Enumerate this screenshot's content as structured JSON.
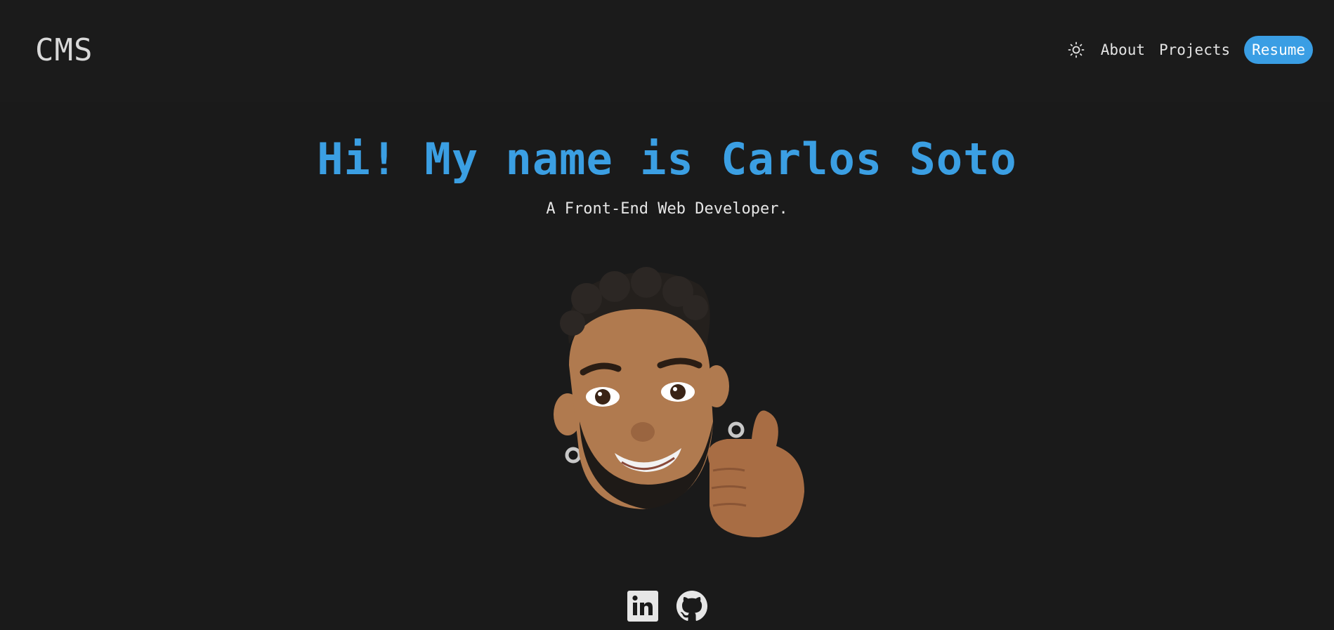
{
  "header": {
    "logo": "CMS",
    "nav": {
      "theme_icon": "sun-icon",
      "about": "About",
      "projects": "Projects",
      "resume": "Resume"
    }
  },
  "hero": {
    "title": "Hi! My name is Carlos Soto",
    "subtitle": "A Front-End Web Developer.",
    "avatar_icon": "memoji-thumbs-up-avatar"
  },
  "socials": {
    "linkedin_icon": "linkedin-icon",
    "github_icon": "github-icon"
  },
  "colors": {
    "background": "#1a1a1a",
    "accent": "#3b9fe3",
    "text": "#e3e3e3"
  }
}
